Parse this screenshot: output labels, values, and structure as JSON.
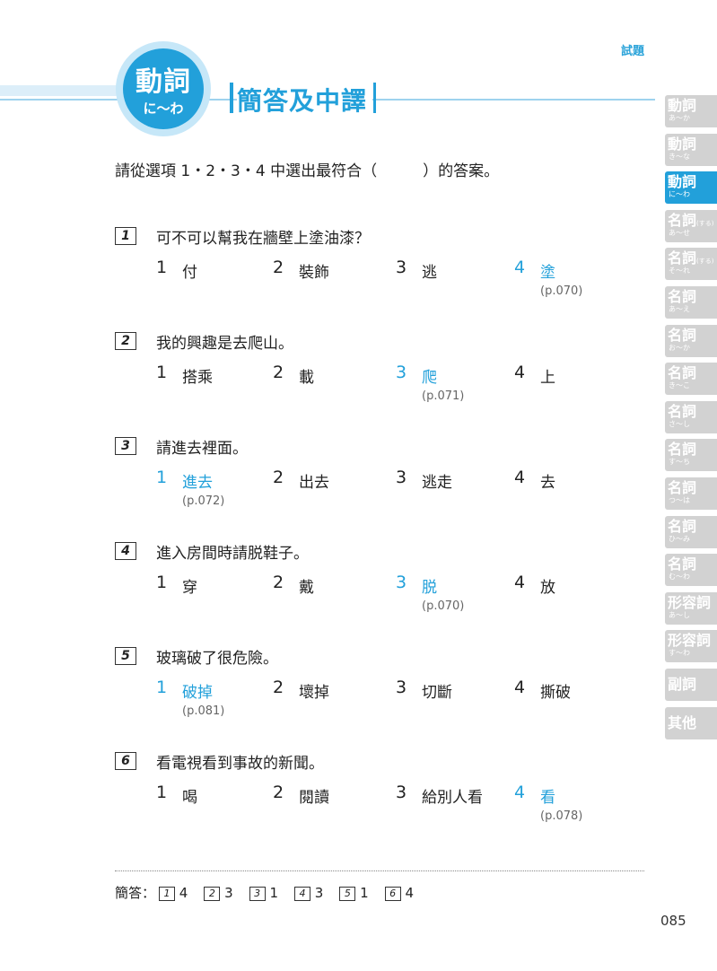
{
  "header": {
    "section_label": "試題"
  },
  "badge": {
    "main": "動詞",
    "sub": "に〜わ"
  },
  "title": "簡答及中譯",
  "instruction": "請從選項 1・2・3・4 中選出最符合（　　　）的答案。",
  "questions": [
    {
      "num": "1",
      "text": "可不可以幫我在牆壁上塗油漆？",
      "options": [
        {
          "n": "1",
          "w": "付",
          "ref": ""
        },
        {
          "n": "2",
          "w": "裝飾",
          "ref": ""
        },
        {
          "n": "3",
          "w": "逃",
          "ref": ""
        },
        {
          "n": "4",
          "w": "塗",
          "ref": "(p.070)"
        }
      ],
      "correct": 3
    },
    {
      "num": "2",
      "text": "我的興趣是去爬山。",
      "options": [
        {
          "n": "1",
          "w": "搭乘",
          "ref": ""
        },
        {
          "n": "2",
          "w": "載",
          "ref": ""
        },
        {
          "n": "3",
          "w": "爬",
          "ref": "(p.071)"
        },
        {
          "n": "4",
          "w": "上",
          "ref": ""
        }
      ],
      "correct": 2
    },
    {
      "num": "3",
      "text": "請進去裡面。",
      "options": [
        {
          "n": "1",
          "w": "進去",
          "ref": "(p.072)"
        },
        {
          "n": "2",
          "w": "出去",
          "ref": ""
        },
        {
          "n": "3",
          "w": "逃走",
          "ref": ""
        },
        {
          "n": "4",
          "w": "去",
          "ref": ""
        }
      ],
      "correct": 0
    },
    {
      "num": "4",
      "text": "進入房間時請脱鞋子。",
      "options": [
        {
          "n": "1",
          "w": "穿",
          "ref": ""
        },
        {
          "n": "2",
          "w": "戴",
          "ref": ""
        },
        {
          "n": "3",
          "w": "脱",
          "ref": "(p.070)"
        },
        {
          "n": "4",
          "w": "放",
          "ref": ""
        }
      ],
      "correct": 2
    },
    {
      "num": "5",
      "text": "玻璃破了很危險。",
      "options": [
        {
          "n": "1",
          "w": "破掉",
          "ref": "(p.081)"
        },
        {
          "n": "2",
          "w": "壞掉",
          "ref": ""
        },
        {
          "n": "3",
          "w": "切斷",
          "ref": ""
        },
        {
          "n": "4",
          "w": "撕破",
          "ref": ""
        }
      ],
      "correct": 0
    },
    {
      "num": "6",
      "text": "看電視看到事故的新聞。",
      "options": [
        {
          "n": "1",
          "w": "喝",
          "ref": ""
        },
        {
          "n": "2",
          "w": "閱讀",
          "ref": ""
        },
        {
          "n": "3",
          "w": "給別人看",
          "ref": ""
        },
        {
          "n": "4",
          "w": "看",
          "ref": "(p.078)"
        }
      ],
      "correct": 3
    }
  ],
  "answers": {
    "label": "簡答：",
    "items": [
      {
        "q": "1",
        "a": "4"
      },
      {
        "q": "2",
        "a": "3"
      },
      {
        "q": "3",
        "a": "1"
      },
      {
        "q": "4",
        "a": "3"
      },
      {
        "q": "5",
        "a": "1"
      },
      {
        "q": "6",
        "a": "4"
      }
    ]
  },
  "page_number": "085",
  "side_tabs": [
    {
      "main": "動詞",
      "sup": "",
      "sub": "あ〜か",
      "active": false
    },
    {
      "main": "動詞",
      "sup": "",
      "sub": "き〜な",
      "active": false
    },
    {
      "main": "動詞",
      "sup": "",
      "sub": "に〜わ",
      "active": true
    },
    {
      "main": "名詞",
      "sup": "(する)",
      "sub": "あ〜せ",
      "active": false
    },
    {
      "main": "名詞",
      "sup": "(する)",
      "sub": "そ〜れ",
      "active": false
    },
    {
      "main": "名詞",
      "sup": "",
      "sub": "あ〜え",
      "active": false
    },
    {
      "main": "名詞",
      "sup": "",
      "sub": "お〜か",
      "active": false
    },
    {
      "main": "名詞",
      "sup": "",
      "sub": "き〜こ",
      "active": false
    },
    {
      "main": "名詞",
      "sup": "",
      "sub": "さ〜し",
      "active": false
    },
    {
      "main": "名詞",
      "sup": "",
      "sub": "す〜ち",
      "active": false
    },
    {
      "main": "名詞",
      "sup": "",
      "sub": "つ〜は",
      "active": false
    },
    {
      "main": "名詞",
      "sup": "",
      "sub": "ひ〜み",
      "active": false
    },
    {
      "main": "名詞",
      "sup": "",
      "sub": "む〜わ",
      "active": false
    },
    {
      "main": "形容詞",
      "sup": "",
      "sub": "あ〜し",
      "active": false
    },
    {
      "main": "形容詞",
      "sup": "",
      "sub": "す〜わ",
      "active": false
    },
    {
      "main": "副詞",
      "sup": "",
      "sub": "",
      "active": false
    },
    {
      "main": "其他",
      "sup": "",
      "sub": "",
      "active": false
    }
  ],
  "colors": {
    "accent": "#22a0da",
    "tab_inactive": "#d2d2d2"
  }
}
